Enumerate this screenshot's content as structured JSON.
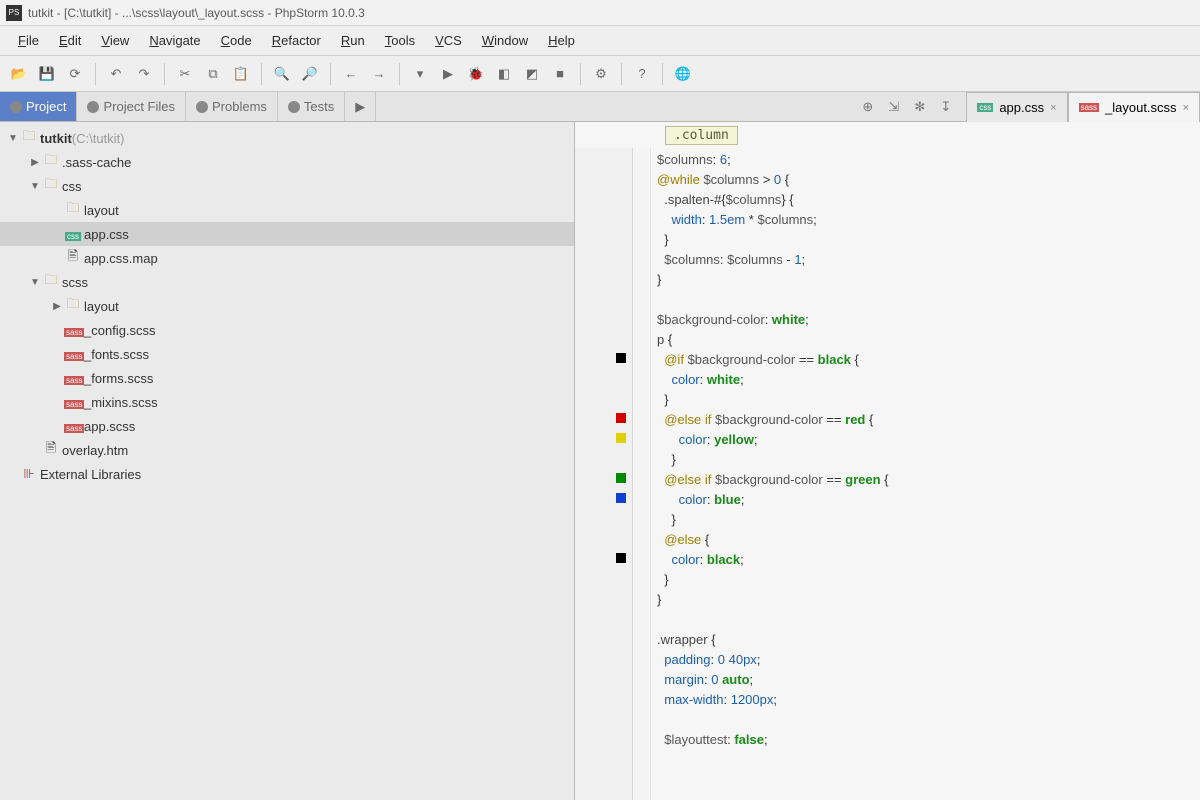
{
  "window": {
    "title": "tutkit - [C:\\tutkit] - ...\\scss\\layout\\_layout.scss - PhpStorm 10.0.3"
  },
  "menu": [
    "File",
    "Edit",
    "View",
    "Navigate",
    "Code",
    "Refactor",
    "Run",
    "Tools",
    "VCS",
    "Window",
    "Help"
  ],
  "nav_tabs": [
    {
      "label": "Project",
      "active": true
    },
    {
      "label": "Project Files",
      "active": false
    },
    {
      "label": "Problems",
      "active": false
    },
    {
      "label": "Tests",
      "active": false
    }
  ],
  "editor_tabs": [
    {
      "label": "app.css",
      "active": false
    },
    {
      "label": "_layout.scss",
      "active": true
    }
  ],
  "breadcrumb": {
    "chip": ".column"
  },
  "tree": [
    {
      "indent": 0,
      "arrow": "▼",
      "icon": "folder",
      "label": "tutkit",
      "suffix": " (C:\\tutkit)"
    },
    {
      "indent": 1,
      "arrow": "▶",
      "icon": "folder",
      "label": ".sass-cache"
    },
    {
      "indent": 1,
      "arrow": "▼",
      "icon": "folder",
      "label": "css"
    },
    {
      "indent": 2,
      "arrow": "",
      "icon": "folder",
      "label": "layout"
    },
    {
      "indent": 2,
      "arrow": "",
      "icon": "css",
      "label": "app.css",
      "selected": true
    },
    {
      "indent": 2,
      "arrow": "",
      "icon": "file",
      "label": "app.css.map"
    },
    {
      "indent": 1,
      "arrow": "▼",
      "icon": "folder",
      "label": "scss"
    },
    {
      "indent": 2,
      "arrow": "▶",
      "icon": "folder",
      "label": "layout"
    },
    {
      "indent": 2,
      "arrow": "",
      "icon": "scss",
      "label": "_config.scss"
    },
    {
      "indent": 2,
      "arrow": "",
      "icon": "scss",
      "label": "_fonts.scss"
    },
    {
      "indent": 2,
      "arrow": "",
      "icon": "scss",
      "label": "_forms.scss"
    },
    {
      "indent": 2,
      "arrow": "",
      "icon": "scss",
      "label": "_mixins.scss"
    },
    {
      "indent": 2,
      "arrow": "",
      "icon": "scss",
      "label": "app.scss"
    },
    {
      "indent": 1,
      "arrow": "",
      "icon": "html",
      "label": "overlay.htm"
    },
    {
      "indent": 0,
      "arrow": "",
      "icon": "lib",
      "label": "External Libraries"
    }
  ],
  "gutter_swatches": {
    "10": "#000000",
    "13": "#d40000",
    "14": "#e0d000",
    "16": "#008a00",
    "17": "#1040d0",
    "20": "#000000"
  },
  "code": {
    "lines": [
      [
        [
          "var",
          "$columns"
        ],
        [
          "op",
          ": "
        ],
        [
          "num",
          "6"
        ],
        [
          "op",
          ";"
        ]
      ],
      [
        [
          "kw",
          "@while"
        ],
        [
          "op",
          " "
        ],
        [
          "var",
          "$columns"
        ],
        [
          "op",
          " > "
        ],
        [
          "num",
          "0"
        ],
        [
          "op",
          " {"
        ]
      ],
      [
        [
          "op",
          "  ."
        ],
        [
          "sel",
          "spalten-"
        ],
        [
          "op",
          "#{"
        ],
        [
          "var",
          "$columns"
        ],
        [
          "op",
          "} {"
        ]
      ],
      [
        [
          "op",
          "    "
        ],
        [
          "prop",
          "width"
        ],
        [
          "op",
          ": "
        ],
        [
          "num",
          "1.5em"
        ],
        [
          "op",
          " * "
        ],
        [
          "var",
          "$columns"
        ],
        [
          "op",
          ";"
        ]
      ],
      [
        [
          "op",
          "  }"
        ]
      ],
      [
        [
          "op",
          "  "
        ],
        [
          "var",
          "$columns"
        ],
        [
          "op",
          ": "
        ],
        [
          "var",
          "$columns"
        ],
        [
          "op",
          " - "
        ],
        [
          "num",
          "1"
        ],
        [
          "op",
          ";"
        ]
      ],
      [
        [
          "op",
          "}"
        ]
      ],
      [],
      [
        [
          "var",
          "$background-color"
        ],
        [
          "op",
          ": "
        ],
        [
          "str",
          "white"
        ],
        [
          "op",
          ";"
        ]
      ],
      [
        [
          "sel",
          "p"
        ],
        [
          "op",
          " {"
        ]
      ],
      [
        [
          "op",
          "  "
        ],
        [
          "kw",
          "@if"
        ],
        [
          "op",
          " "
        ],
        [
          "var",
          "$background-color"
        ],
        [
          "op",
          " == "
        ],
        [
          "str",
          "black"
        ],
        [
          "op",
          " {"
        ]
      ],
      [
        [
          "op",
          "    "
        ],
        [
          "prop",
          "color"
        ],
        [
          "op",
          ": "
        ],
        [
          "str",
          "white"
        ],
        [
          "op",
          ";"
        ]
      ],
      [
        [
          "op",
          "  }"
        ]
      ],
      [
        [
          "op",
          "  "
        ],
        [
          "kw",
          "@else if"
        ],
        [
          "op",
          " "
        ],
        [
          "var",
          "$background-color"
        ],
        [
          "op",
          " == "
        ],
        [
          "str",
          "red"
        ],
        [
          "op",
          " {"
        ]
      ],
      [
        [
          "op",
          "      "
        ],
        [
          "prop",
          "color"
        ],
        [
          "op",
          ": "
        ],
        [
          "str",
          "yellow"
        ],
        [
          "op",
          ";"
        ]
      ],
      [
        [
          "op",
          "    }"
        ]
      ],
      [
        [
          "op",
          "  "
        ],
        [
          "kw",
          "@else if"
        ],
        [
          "op",
          " "
        ],
        [
          "var",
          "$background-color"
        ],
        [
          "op",
          " == "
        ],
        [
          "str",
          "green"
        ],
        [
          "op",
          " {"
        ]
      ],
      [
        [
          "op",
          "      "
        ],
        [
          "prop",
          "color"
        ],
        [
          "op",
          ": "
        ],
        [
          "str",
          "blue"
        ],
        [
          "op",
          ";"
        ]
      ],
      [
        [
          "op",
          "    }"
        ]
      ],
      [
        [
          "op",
          "  "
        ],
        [
          "kw",
          "@else"
        ],
        [
          "op",
          " {"
        ]
      ],
      [
        [
          "op",
          "    "
        ],
        [
          "prop",
          "color"
        ],
        [
          "op",
          ": "
        ],
        [
          "str",
          "black"
        ],
        [
          "op",
          ";"
        ]
      ],
      [
        [
          "op",
          "  }"
        ]
      ],
      [
        [
          "op",
          "}"
        ]
      ],
      [],
      [
        [
          "op",
          "."
        ],
        [
          "sel",
          "wrapper"
        ],
        [
          "op",
          " {"
        ]
      ],
      [
        [
          "op",
          "  "
        ],
        [
          "prop",
          "padding"
        ],
        [
          "op",
          ": "
        ],
        [
          "num",
          "0"
        ],
        [
          "op",
          " "
        ],
        [
          "num",
          "40px"
        ],
        [
          "op",
          ";"
        ]
      ],
      [
        [
          "op",
          "  "
        ],
        [
          "prop",
          "margin"
        ],
        [
          "op",
          ": "
        ],
        [
          "num",
          "0"
        ],
        [
          "op",
          " "
        ],
        [
          "str",
          "auto"
        ],
        [
          "op",
          ";"
        ]
      ],
      [
        [
          "op",
          "  "
        ],
        [
          "prop",
          "max-width"
        ],
        [
          "op",
          ": "
        ],
        [
          "num",
          "1200px"
        ],
        [
          "op",
          ";"
        ]
      ],
      [],
      [
        [
          "op",
          "  "
        ],
        [
          "var",
          "$layouttest"
        ],
        [
          "op",
          ": "
        ],
        [
          "str",
          "false"
        ],
        [
          "op",
          ";"
        ]
      ]
    ]
  },
  "toolbar_icons": [
    "open",
    "save",
    "refresh",
    "",
    "undo",
    "redo",
    "",
    "cut",
    "copy",
    "paste",
    "",
    "zoom-in",
    "zoom-out",
    "",
    "back",
    "forward",
    "",
    "config-dropdown",
    "run",
    "debug",
    "coverage",
    "run-coverage",
    "stop",
    "",
    "settings",
    "",
    "help",
    "",
    "browser"
  ]
}
